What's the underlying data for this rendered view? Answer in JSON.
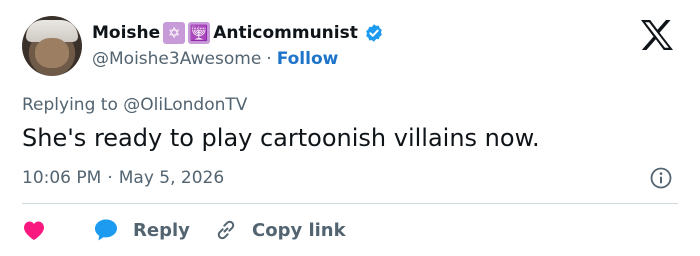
{
  "user": {
    "display_name_before": "Moishe",
    "emoji_1": "✡",
    "emoji_2": "🕎",
    "display_name_after": "Anticommunist",
    "handle": "@Moishe3Awesome",
    "separator": "·",
    "follow_label": "Follow",
    "verified": true
  },
  "reply_context": {
    "prefix": "Replying to",
    "mention": "@OliLondonTV"
  },
  "tweet": {
    "text": "She's ready to play cartoonish villains now.",
    "time": "10:06 PM",
    "separator": "·",
    "date": "May 5, 2026"
  },
  "actions": {
    "reply_label": "Reply",
    "copy_label": "Copy link"
  },
  "icons": {
    "logo": "x-logo-icon",
    "verified": "verified-badge-icon",
    "info": "info-icon",
    "like": "heart-icon",
    "reply": "speech-bubble-icon",
    "copy": "link-icon"
  },
  "colors": {
    "text": "#0f1419",
    "secondary": "#536471",
    "follow": "#1d74c9",
    "verified": "#1d9bf0",
    "like": "#f91880",
    "reply": "#1d9bf0",
    "emoji_bg": "#c79ad8",
    "divider": "#cfd9de"
  }
}
